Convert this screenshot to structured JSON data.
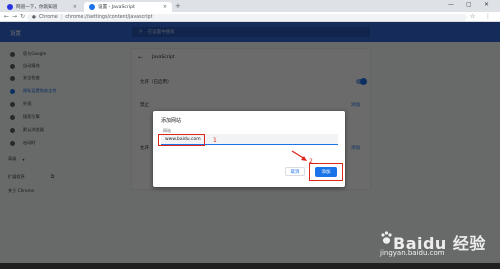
{
  "browser": {
    "tabs": [
      {
        "title": "网道一下，你就知道",
        "active": false,
        "icon_color": "#2932e1"
      },
      {
        "title": "设置 - JavaScript",
        "active": true,
        "icon_color": "#1a73e8"
      }
    ],
    "new_tab_symbol": "+",
    "window_controls": [
      "—",
      "▢",
      "✕"
    ],
    "address": {
      "lock_label": "Chrome",
      "separator": "|",
      "url": "chrome://settings/content/javascript"
    }
  },
  "settings": {
    "header_title": "设置",
    "search_placeholder": "在设置中搜索",
    "sidebar_items": [
      {
        "label": "您与Google",
        "active": false
      },
      {
        "label": "自动填充",
        "active": false
      },
      {
        "label": "安全检查",
        "active": false
      },
      {
        "label": "隐私设置和安全性",
        "active": true
      },
      {
        "label": "外观",
        "active": false
      },
      {
        "label": "搜索引擎",
        "active": false
      },
      {
        "label": "默认浏览器",
        "active": false
      },
      {
        "label": "启动时",
        "active": false
      },
      {
        "label": "高级",
        "active": false
      },
      {
        "label": "扩展程序",
        "active": false
      },
      {
        "label": "关于 Chrome",
        "active": false
      }
    ],
    "content_title": "JavaScript",
    "allowed_label": "允许（已启用）",
    "block_label": "禁止",
    "allow_label": "允许",
    "add_link": "添加"
  },
  "dialog": {
    "title": "添加网站",
    "field_label": "网站",
    "field_value": "www.baidu.com",
    "cancel_label": "取消",
    "add_label": "添加"
  },
  "annotations": {
    "step1": "1",
    "step2": "2",
    "highlight_color": "#e0261b"
  },
  "watermark": {
    "brand": "Baidu 经验",
    "url": "jingyan.baidu.com"
  }
}
